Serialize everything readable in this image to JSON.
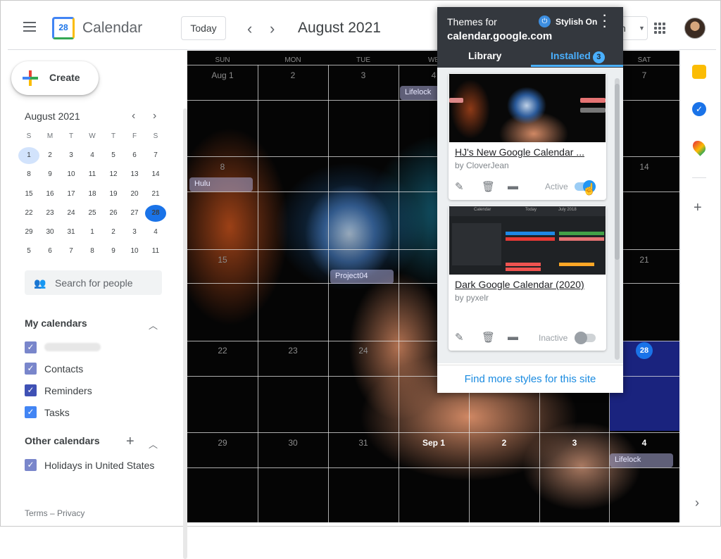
{
  "header": {
    "app_title": "Calendar",
    "logo_day": "28",
    "today_label": "Today",
    "prev_icon": "‹",
    "next_icon": "›",
    "month_title": "August 2021",
    "view_selector_partial": "h"
  },
  "sidebar": {
    "create_label": "Create",
    "mini_month": "August 2021",
    "weekday_letters": [
      "S",
      "M",
      "T",
      "W",
      "T",
      "F",
      "S"
    ],
    "weeks": [
      [
        "1",
        "2",
        "3",
        "4",
        "5",
        "6",
        "7"
      ],
      [
        "8",
        "9",
        "10",
        "11",
        "12",
        "13",
        "14"
      ],
      [
        "15",
        "16",
        "17",
        "18",
        "19",
        "20",
        "21"
      ],
      [
        "22",
        "23",
        "24",
        "25",
        "26",
        "27",
        "28"
      ],
      [
        "29",
        "30",
        "31",
        "1",
        "2",
        "3",
        "4"
      ],
      [
        "5",
        "6",
        "7",
        "8",
        "9",
        "10",
        "11"
      ]
    ],
    "search_placeholder": "Search for people",
    "my_calendars_title": "My calendars",
    "my_calendars": [
      {
        "label": "",
        "color": "#7986cb"
      },
      {
        "label": "Contacts",
        "color": "#7986cb"
      },
      {
        "label": "Reminders",
        "color": "#3f51b5"
      },
      {
        "label": "Tasks",
        "color": "#4285f4"
      }
    ],
    "other_calendars_title": "Other calendars",
    "other_calendars": [
      {
        "label": "Holidays in United States",
        "color": "#7986cb"
      }
    ],
    "footer_terms": "Terms",
    "footer_sep": "–",
    "footer_privacy": "Privacy"
  },
  "calendar": {
    "day_headers": [
      "SUN",
      "MON",
      "TUE",
      "WE",
      "",
      "",
      "SAT"
    ],
    "weeks": [
      [
        "Aug 1",
        "2",
        "3",
        "4",
        "",
        "",
        "7"
      ],
      [
        "8",
        "",
        "",
        "",
        "",
        "",
        "14"
      ],
      [
        "15",
        "",
        "",
        "",
        "",
        "",
        "21"
      ],
      [
        "22",
        "23",
        "24",
        "",
        "",
        "",
        "28"
      ],
      [
        "29",
        "30",
        "31",
        "Sep 1",
        "2",
        "3",
        "4"
      ]
    ],
    "events": {
      "lifelock_1": "Lifelock",
      "hulu": "Hulu",
      "project": "Project04",
      "lifelock_2": "Lifelock"
    }
  },
  "stylish_popup": {
    "title_line1": "Themes for",
    "title_line2": "calendar.google.com",
    "power_label": "Stylish On",
    "tab_library": "Library",
    "tab_installed": "Installed",
    "installed_count": "3",
    "styles": [
      {
        "title": "HJ's New Google Calendar ...",
        "author": "by CloverJean",
        "status": "Active",
        "enabled": true
      },
      {
        "title": "Dark Google Calendar (2020)",
        "author": "by pyxelr",
        "status": "Inactive",
        "enabled": false
      }
    ],
    "thumb2_labels": {
      "app": "Calendar",
      "today": "Today",
      "month": "July 2018"
    },
    "footer_link": "Find more styles for this site"
  },
  "colors": {
    "accent": "#1a73e8",
    "popup_header": "#34383e",
    "popup_accent": "#4ab0ff",
    "today_cell": "#1a237e"
  }
}
